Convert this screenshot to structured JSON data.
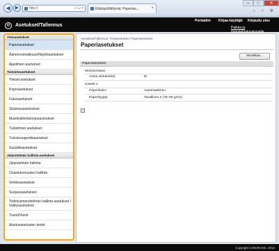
{
  "browser": {
    "url": "http://",
    "address_tools": "⌕ ↻ ×",
    "tab_title": "Etäkäyttöliittymä: Paperias...",
    "window_min": "—",
    "window_max": "□",
    "window_close": "✕",
    "toolbar_icons": "⌂ ☆ ⚙"
  },
  "header": {
    "app_title": "Asetukset/Tallennus",
    "portal_link": "Portaaliin",
    "user_label": "Kirjaa käyttäjä:",
    "logout_link": "Kirjaudu ulos",
    "portal_settings": "Paikka ja järjestelmänvalvojalle"
  },
  "sidebar": {
    "sections": [
      {
        "title": "Yleisasetukset",
        "items": [
          "Paperiasetukset",
          "Äänenvoimakkuus/Näyttöasetukset",
          "Ajastimen asetukset"
        ]
      },
      {
        "title": "Toimintoasetukset",
        "items": [
          "Yleiset asetukset",
          "Kopioasetukset",
          "Faksiasetukset",
          "Skannausasetukset",
          "Muistivälinetulostusasetukset",
          "Tulostimen asetukset",
          "Tulostusraporttiasetukset",
          "Suosikkiasetukset"
        ]
      },
      {
        "title": "Järjestelmän hallinta-asetukset",
        "items": [
          "Järjestelmän hallinta",
          "Osastotunnusten hallinta",
          "Verkkoasetukset",
          "Suojausasetukset",
          "Todistusmenetelmän hallinta-asetukset / Valitysasetukset",
          "Tuonti/Vienti",
          "Alustusasetusten tiedot"
        ]
      }
    ]
  },
  "main": {
    "breadcrumb": "Asetukset/Tallennus: Yleisasetukset: Paperiasetukset",
    "title": "Paperiasetukset",
    "edit_button": "Muokkaa...",
    "section_title": "Paperiasetukset",
    "rows": [
      {
        "label": "Monitoimitaso",
        "value": ""
      },
      {
        "label": "Aseta oletukseksi:",
        "value": "Ei"
      },
      {
        "label": "Kasetti 1",
        "value": ""
      },
      {
        "label": "Paperikoko:",
        "value": "Automaattinen"
      },
      {
        "label": "Paperityyppi:",
        "value": "Tavallinen 2 (76–90 g/m2)"
      }
    ],
    "page_top_icon": "↑"
  },
  "footer": {
    "copyright": "Copyright CANON INC. 2014"
  }
}
